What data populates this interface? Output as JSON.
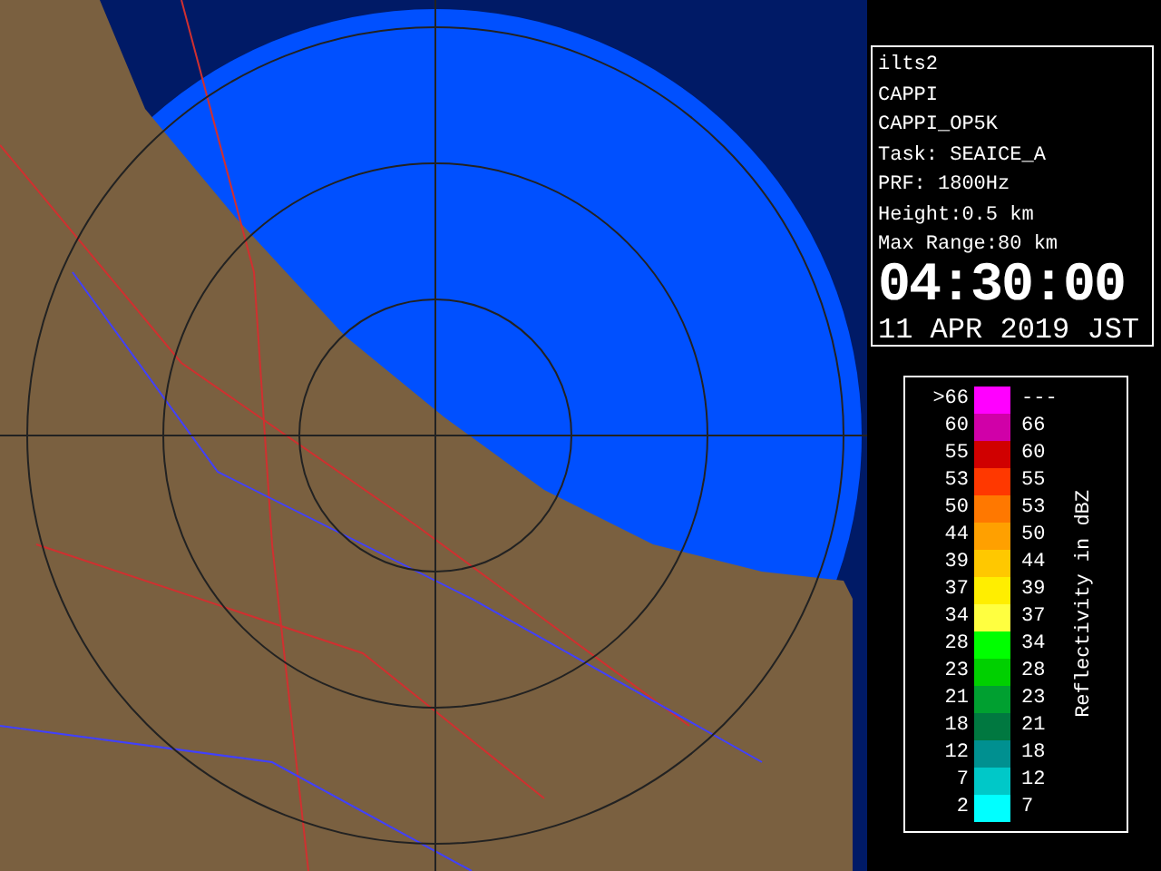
{
  "info_panel": {
    "lines": [
      "ilts2",
      "CAPPI",
      "CAPPI_OP5K",
      "Task: SEAICE_A",
      "PRF: 1800Hz",
      "Height:0.5 km",
      "Max Range:80 km"
    ],
    "time": "04:30:00",
    "date": "11 APR 2019 JST"
  },
  "legend": {
    "title": "Reflectivity in dBZ",
    "rows": [
      {
        "low": ">66",
        "high": "---",
        "color": "#ff00ff"
      },
      {
        "low": "60",
        "high": "66",
        "color": "#d000a8"
      },
      {
        "low": "55",
        "high": "60",
        "color": "#d00000"
      },
      {
        "low": "53",
        "high": "55",
        "color": "#ff3800"
      },
      {
        "low": "50",
        "high": "53",
        "color": "#ff7800"
      },
      {
        "low": "44",
        "high": "50",
        "color": "#ffa000"
      },
      {
        "low": "39",
        "high": "44",
        "color": "#ffc800"
      },
      {
        "low": "37",
        "high": "39",
        "color": "#ffee00"
      },
      {
        "low": "34",
        "high": "37",
        "color": "#ffff40"
      },
      {
        "low": "28",
        "high": "34",
        "color": "#00ff00"
      },
      {
        "low": "23",
        "high": "28",
        "color": "#00d000"
      },
      {
        "low": "21",
        "high": "23",
        "color": "#00a030"
      },
      {
        "low": "18",
        "high": "21",
        "color": "#007840"
      },
      {
        "low": "12",
        "high": "18",
        "color": "#009090"
      },
      {
        "low": "7",
        "high": "12",
        "color": "#00c8c8"
      },
      {
        "low": "2",
        "high": "7",
        "color": "#00ffff"
      }
    ]
  }
}
